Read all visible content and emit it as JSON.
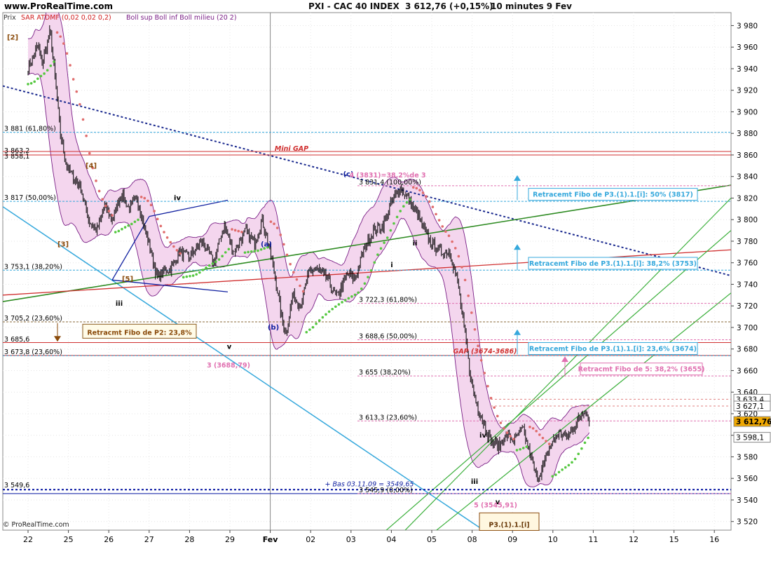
{
  "header": {
    "site": "www.ProRealTime.com",
    "title": "PXI - CAC 40 INDEX",
    "price": "3 612,76 (+0,15%)",
    "timeframe": "10 minutes 9 Fev"
  },
  "legend": {
    "prix": "Prix",
    "sar": "SAR ATDMF (0,02 0,02 0,2)",
    "boll": "Boll sup Boll inf Boll milieu (20 2)"
  },
  "copyright": "© ProRealTime.com",
  "colors": {
    "candles": "#000000",
    "boll_fill": "#f4d6ee",
    "boll_line": "#7a1f86",
    "sar_up": "#55c840",
    "sar_down": "#e06c6c",
    "fibo_blue": "#35a8dc",
    "fibo_pink": "#e070b0",
    "red_line": "#d03030",
    "green_line": "#2e8b22",
    "navy": "#1b2a8f",
    "brown": "#8a4a0a"
  },
  "chart_data": {
    "type": "candlestick",
    "title": "PXI - CAC 40 INDEX",
    "ylim": [
      3512,
      3992
    ],
    "y_ticks": [
      3520,
      3540,
      3560,
      3580,
      3600,
      3620,
      3640,
      3660,
      3680,
      3700,
      3720,
      3740,
      3760,
      3780,
      3800,
      3820,
      3840,
      3860,
      3880,
      3900,
      3920,
      3940,
      3960,
      3980
    ],
    "y_tick_labels": [
      "3 520",
      "3 540",
      "3 560",
      "3 580",
      "3 600",
      "3 620",
      "3 640",
      "3 660",
      "3 680",
      "3 700",
      "3 720",
      "3 740",
      "3 760",
      "3 780",
      "3 800",
      "3 820",
      "3 840",
      "3 860",
      "3 880",
      "3 900",
      "3 920",
      "3 940",
      "3 960",
      "3 980"
    ],
    "x_ticks": [
      "22",
      "25",
      "26",
      "27",
      "28",
      "29",
      "Fev",
      "02",
      "03",
      "04",
      "05",
      "08",
      "09",
      "10",
      "11",
      "12",
      "15",
      "16"
    ],
    "series_path": [
      [
        0,
        3940
      ],
      [
        0.25,
        3962
      ],
      [
        0.35,
        3945
      ],
      [
        0.55,
        3975
      ],
      [
        0.7,
        3920
      ],
      [
        0.8,
        3880
      ],
      [
        0.95,
        3850
      ],
      [
        1.1,
        3840
      ],
      [
        1.3,
        3830
      ],
      [
        1.5,
        3800
      ],
      [
        1.7,
        3790
      ],
      [
        1.9,
        3812
      ],
      [
        2.1,
        3800
      ],
      [
        2.3,
        3825
      ],
      [
        2.5,
        3810
      ],
      [
        2.7,
        3820
      ],
      [
        2.9,
        3790
      ],
      [
        3.05,
        3770
      ],
      [
        3.2,
        3745
      ],
      [
        3.35,
        3752
      ],
      [
        3.55,
        3755
      ],
      [
        3.75,
        3770
      ],
      [
        4.0,
        3765
      ],
      [
        4.3,
        3780
      ],
      [
        4.6,
        3760
      ],
      [
        4.85,
        3795
      ],
      [
        5.1,
        3770
      ],
      [
        5.4,
        3790
      ],
      [
        5.6,
        3778
      ],
      [
        5.8,
        3800
      ],
      [
        6.0,
        3770
      ],
      [
        6.15,
        3740
      ],
      [
        6.3,
        3705
      ],
      [
        6.4,
        3695
      ],
      [
        6.55,
        3730
      ],
      [
        6.75,
        3720
      ],
      [
        6.95,
        3750
      ],
      [
        7.15,
        3755
      ],
      [
        7.4,
        3745
      ],
      [
        7.65,
        3728
      ],
      [
        7.9,
        3750
      ],
      [
        8.1,
        3745
      ],
      [
        8.3,
        3770
      ],
      [
        8.55,
        3790
      ],
      [
        8.8,
        3795
      ],
      [
        9.0,
        3815
      ],
      [
        9.2,
        3830
      ],
      [
        9.45,
        3818
      ],
      [
        9.7,
        3800
      ],
      [
        9.95,
        3780
      ],
      [
        10.2,
        3770
      ],
      [
        10.45,
        3770
      ],
      [
        10.65,
        3740
      ],
      [
        10.8,
        3700
      ],
      [
        10.95,
        3655
      ],
      [
        11.1,
        3630
      ],
      [
        11.25,
        3615
      ],
      [
        11.45,
        3595
      ],
      [
        11.65,
        3590
      ],
      [
        11.85,
        3600
      ],
      [
        12.05,
        3595
      ],
      [
        12.25,
        3606
      ],
      [
        12.45,
        3580
      ],
      [
        12.6,
        3560
      ],
      [
        12.75,
        3570
      ],
      [
        12.95,
        3592
      ],
      [
        13.15,
        3602
      ],
      [
        13.35,
        3598
      ],
      [
        13.6,
        3612
      ],
      [
        13.8,
        3625
      ],
      [
        13.9,
        3613
      ]
    ],
    "current_price": 3612.76,
    "current_price_label": "3 612,76",
    "right_badges": [
      {
        "value": 3633.4,
        "label": "3 633,4"
      },
      {
        "value": 3627.1,
        "label": "3 627,1"
      },
      {
        "value": 3598.1,
        "label": "3 598,1"
      }
    ],
    "fibo_levels": [
      {
        "value": 3881,
        "label": "3 881 (61,80%)",
        "color": "fibo_blue",
        "side": "left"
      },
      {
        "value": 3817,
        "label": "3 817 (50,00%)",
        "color": "fibo_blue",
        "side": "left"
      },
      {
        "value": 3753.1,
        "label": "3 753,1 (38,20%)",
        "color": "fibo_blue",
        "side": "left"
      },
      {
        "value": 3705.2,
        "label": "3 705,2 (23,60%)",
        "color": "brown",
        "side": "left"
      },
      {
        "value": 3673.8,
        "label": "3 673,8 (23,60%)",
        "color": "fibo_blue",
        "side": "left"
      },
      {
        "value": 3831.4,
        "label": "3 831,4 (100,00%)",
        "color": "fibo_pink",
        "side": "mid"
      },
      {
        "value": 3722.3,
        "label": "3 722,3 (61,80%)",
        "color": "fibo_pink",
        "side": "mid"
      },
      {
        "value": 3688.6,
        "label": "3 688,6 (50,00%)",
        "color": "fibo_pink",
        "side": "mid"
      },
      {
        "value": 3655,
        "label": "3 655 (38,20%)",
        "color": "fibo_pink",
        "side": "mid"
      },
      {
        "value": 3613.3,
        "label": "3 613,3 (23,60%)",
        "color": "fibo_pink",
        "side": "mid"
      },
      {
        "value": 3545.9,
        "label": "3 545,9 (0,00%)",
        "color": "fibo_pink",
        "side": "mid"
      }
    ],
    "left_edge_labels": [
      {
        "value": 3863.2,
        "label": "3 863,2"
      },
      {
        "value": 3858,
        "label": "3 858,1"
      },
      {
        "value": 3685.6,
        "label": "3 685,6"
      },
      {
        "value": 3549.6,
        "label": "3 549,6"
      },
      {
        "value": 3545.9,
        "label": "3 545,9 (0,00%)"
      }
    ],
    "wave_labels": [
      "[2]",
      "[4]",
      "[3]",
      "[5]",
      "iii",
      "iv",
      "v",
      "(a)",
      "(b)",
      "(c)",
      "i",
      "ii",
      "iii",
      "iv",
      "v"
    ],
    "annotations": {
      "mini_gap": "Mini GAP",
      "gap": "GAP (3674-3686)",
      "wave4": "4 (3831)=38,2%de 3",
      "wave3": "3 (3688,79)",
      "wave5": "5 (3545,91)",
      "bas": "+ Bas 03.11.09 = 3549,65",
      "p2box": "Retracmt Fibo de P2: 23,8%",
      "box50": "Retracemt Fibo de P3.(1).1.[i]: 50% (3817)",
      "box382": "Retracemt Fibo de P3.(1).1.[i]: 38,2% (3753)",
      "box236": "Retracemt Fibo de P3.(1).1.[i]: 23,6% (3674)",
      "box5": "Retracmt Fibo de 5: 38,2% (3655)",
      "p3": "P3.(1).1.[i]"
    }
  }
}
